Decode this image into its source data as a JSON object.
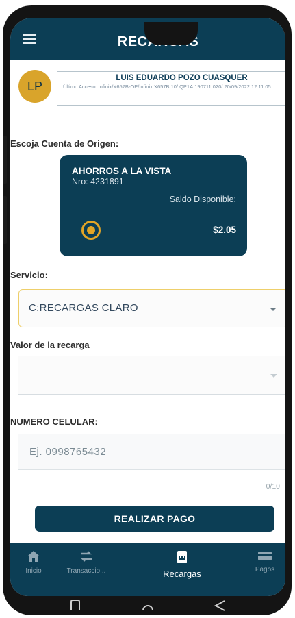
{
  "header": {
    "title": "RECARGAS"
  },
  "user": {
    "initials": "LP",
    "name": "LUIS EDUARDO POZO CUASQUER",
    "last_access": "Último Acceso: Infinix/X657B-OP/Infinix X657B:10/ QP1A.190711.020/ 20/09/2022 12:11:05"
  },
  "origin": {
    "label": "Escoja Cuenta de Origen:",
    "account": {
      "type": "AHORROS A LA VISTA",
      "number": "Nro: 4231891",
      "balance_label": "Saldo Disponible:",
      "balance": "$2.05"
    }
  },
  "service": {
    "label": "Servicio:",
    "selected": "C:RECARGAS CLARO"
  },
  "amount": {
    "label": "Valor de la recarga",
    "selected": ""
  },
  "phone": {
    "label": "NUMERO CELULAR:",
    "placeholder": "Ej. 0998765432",
    "counter": "0/10"
  },
  "actions": {
    "pay_label": "REALIZAR PAGO"
  },
  "bottom_nav": {
    "items": [
      {
        "label": "Inicio",
        "icon": "home-icon"
      },
      {
        "label": "Transaccio...",
        "icon": "transfer-icon"
      },
      {
        "label": "Recargas",
        "icon": "recharge-icon",
        "active": true
      },
      {
        "label": "Pagos",
        "icon": "card-icon"
      }
    ]
  },
  "colors": {
    "primary": "#0c3e55",
    "accent": "#e3a526",
    "background": "#ffffff"
  }
}
